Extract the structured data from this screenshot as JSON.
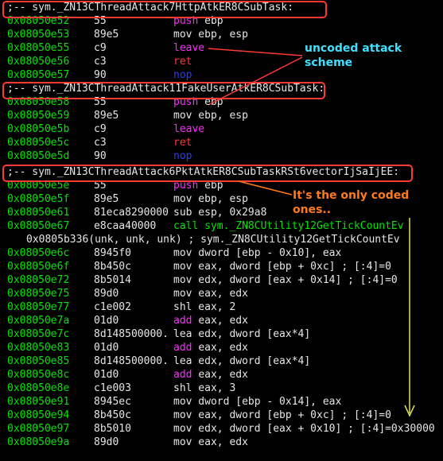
{
  "headers": [
    {
      "text": ";-- sym._ZN13CThreadAttack7HttpAtkER8CSubTask:"
    },
    {
      "text": ";-- sym._ZN13CThreadAttack11FakeUserAtkER8CSubTask:"
    },
    {
      "text": ";-- sym._ZN13CThreadAttack6PktAtkER8CSubTaskRSt6vectorIjSaIjEE:"
    }
  ],
  "xref": "0x0805b336(unk, unk, unk) ; sym._ZN8CUtility12GetTickCountEv",
  "rows": [
    {
      "addr": "0x08050e52",
      "bytes": "55",
      "parts": [
        [
          "k",
          "push "
        ],
        [
          "m",
          "ebp"
        ]
      ]
    },
    {
      "addr": "0x08050e53",
      "bytes": "89e5",
      "parts": [
        [
          "m",
          "mov ebp, esp"
        ]
      ]
    },
    {
      "addr": "0x08050e55",
      "bytes": "c9",
      "parts": [
        [
          "k",
          "leave"
        ]
      ]
    },
    {
      "addr": "0x08050e56",
      "bytes": "c3",
      "parts": [
        [
          "r",
          "ret"
        ]
      ]
    },
    {
      "addr": "0x08050e57",
      "bytes": "90",
      "parts": [
        [
          "n",
          "nop"
        ]
      ]
    },
    {
      "addr": "0x08050e58",
      "bytes": "55",
      "parts": [
        [
          "k",
          "push "
        ],
        [
          "m",
          "ebp"
        ]
      ]
    },
    {
      "addr": "0x08050e59",
      "bytes": "89e5",
      "parts": [
        [
          "m",
          "mov ebp, esp"
        ]
      ]
    },
    {
      "addr": "0x08050e5b",
      "bytes": "c9",
      "parts": [
        [
          "k",
          "leave"
        ]
      ]
    },
    {
      "addr": "0x08050e5c",
      "bytes": "c3",
      "parts": [
        [
          "r",
          "ret"
        ]
      ]
    },
    {
      "addr": "0x08050e5d",
      "bytes": "90",
      "parts": [
        [
          "n",
          "nop"
        ]
      ]
    },
    {
      "addr": "0x08050e5e",
      "bytes": "55",
      "parts": [
        [
          "k",
          "push "
        ],
        [
          "m",
          "ebp"
        ]
      ]
    },
    {
      "addr": "0x08050e5f",
      "bytes": "89e5",
      "parts": [
        [
          "m",
          "mov ebp, esp"
        ]
      ]
    },
    {
      "addr": "0x08050e61",
      "bytes": "81eca8290000",
      "parts": [
        [
          "m",
          "sub esp, 0x29a8"
        ]
      ]
    },
    {
      "addr": "0x08050e67",
      "bytes": "e8caa40000",
      "parts": [
        [
          "g",
          "call sym._ZN8CUtility12GetTickCountEv"
        ]
      ]
    },
    {
      "addr": "0x08050e6c",
      "bytes": "8945f0",
      "parts": [
        [
          "m",
          "mov dword [ebp - 0x10], eax"
        ]
      ]
    },
    {
      "addr": "0x08050e6f",
      "bytes": "8b450c",
      "parts": [
        [
          "m",
          "mov eax, dword [ebp + 0xc] ; [:4]=0"
        ]
      ]
    },
    {
      "addr": "0x08050e72",
      "bytes": "8b5014",
      "parts": [
        [
          "m",
          "mov edx, dword [eax + 0x14] ; [:4]=0"
        ]
      ]
    },
    {
      "addr": "0x08050e75",
      "bytes": "89d0",
      "parts": [
        [
          "m",
          "mov eax, edx"
        ]
      ]
    },
    {
      "addr": "0x08050e77",
      "bytes": "c1e002",
      "parts": [
        [
          "m",
          "shl eax, 2"
        ]
      ]
    },
    {
      "addr": "0x08050e7a",
      "bytes": "01d0",
      "parts": [
        [
          "k",
          "add "
        ],
        [
          "m",
          "eax, edx"
        ]
      ]
    },
    {
      "addr": "0x08050e7c",
      "bytes": "8d148500000.",
      "parts": [
        [
          "m",
          "lea edx, dword [eax*4]"
        ]
      ]
    },
    {
      "addr": "0x08050e83",
      "bytes": "01d0",
      "parts": [
        [
          "k",
          "add "
        ],
        [
          "m",
          "eax, edx"
        ]
      ]
    },
    {
      "addr": "0x08050e85",
      "bytes": "8d148500000.",
      "parts": [
        [
          "m",
          "lea edx, dword [eax*4]"
        ]
      ]
    },
    {
      "addr": "0x08050e8c",
      "bytes": "01d0",
      "parts": [
        [
          "k",
          "add "
        ],
        [
          "m",
          "eax, edx"
        ]
      ]
    },
    {
      "addr": "0x08050e8e",
      "bytes": "c1e003",
      "parts": [
        [
          "m",
          "shl eax, 3"
        ]
      ]
    },
    {
      "addr": "0x08050e91",
      "bytes": "8945ec",
      "parts": [
        [
          "m",
          "mov dword [ebp - 0x14], eax"
        ]
      ]
    },
    {
      "addr": "0x08050e94",
      "bytes": "8b450c",
      "parts": [
        [
          "m",
          "mov eax, dword [ebp + 0xc] ; [:4]=0"
        ]
      ]
    },
    {
      "addr": "0x08050e97",
      "bytes": "8b5010",
      "parts": [
        [
          "m",
          "mov edx, dword [eax + 0x10] ; [:4]=0x30000"
        ]
      ]
    },
    {
      "addr": "0x08050e9a",
      "bytes": "89d0",
      "parts": [
        [
          "m",
          "mov eax, edx"
        ]
      ]
    }
  ],
  "annotations": {
    "uncoded": "uncoded attack scheme",
    "coded": "It's the only coded ones.."
  },
  "colors": {
    "box": "#ff3b30",
    "cyan": "#3fe0ff",
    "orange": "#ff7a1a",
    "yellow": "#e0e060"
  }
}
